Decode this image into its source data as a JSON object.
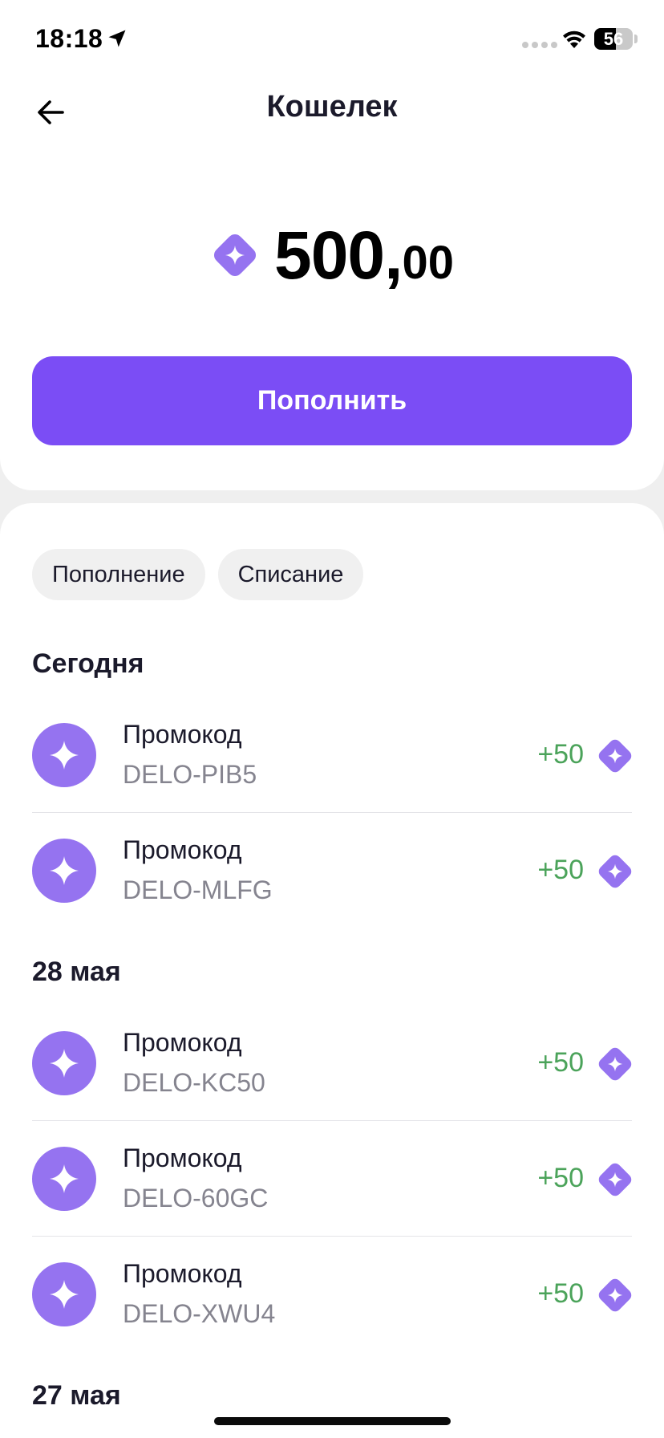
{
  "status_bar": {
    "time": "18:18",
    "battery": "56",
    "battery_level_percent": 56
  },
  "header": {
    "title": "Кошелек"
  },
  "wallet": {
    "balance_int": "500,",
    "balance_frac": "00",
    "topup_label": "Пополнить"
  },
  "filters": [
    {
      "label": "Пополнение"
    },
    {
      "label": "Списание"
    }
  ],
  "sections": [
    {
      "label": "Сегодня",
      "items": [
        {
          "title": "Промокод",
          "code": "DELO-PIB5",
          "amount": "+50"
        },
        {
          "title": "Промокод",
          "code": "DELO-MLFG",
          "amount": "+50"
        }
      ]
    },
    {
      "label": "28 мая",
      "items": [
        {
          "title": "Промокод",
          "code": "DELO-KC50",
          "amount": "+50"
        },
        {
          "title": "Промокод",
          "code": "DELO-60GC",
          "amount": "+50"
        },
        {
          "title": "Промокод",
          "code": "DELO-XWU4",
          "amount": "+50"
        }
      ]
    },
    {
      "label": "27 мая",
      "items": []
    }
  ],
  "colors": {
    "accent": "#7b4df5",
    "avatar": "#9573f0",
    "positive": "#4ba35a",
    "secondary_text": "#85848f"
  },
  "icons": {
    "back": "arrow-left-icon",
    "coin": "diamond-coin-icon",
    "promo": "sparkle-icon",
    "location": "location-arrow-icon",
    "wifi": "wifi-icon"
  }
}
